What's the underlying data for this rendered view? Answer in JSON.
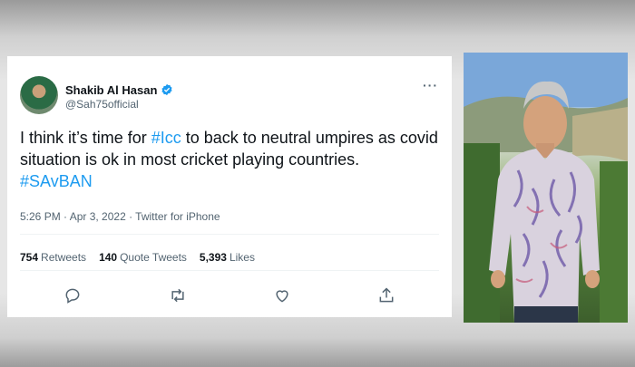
{
  "tweet": {
    "display_name": "Shakib Al Hasan",
    "handle": "@Sah75official",
    "text_part1": "I think it’s time for ",
    "hashtag1": "#Icc",
    "text_part2": " to back to neutral umpires as covid situation is ok in most cricket playing countries.",
    "hashtag2": "#SAvBAN",
    "timestamp": "5:26 PM · Apr 3, 2022 · Twitter for iPhone",
    "stats": {
      "retweets_count": "754",
      "retweets_label": "Retweets",
      "quotes_count": "140",
      "quotes_label": "Quote Tweets",
      "likes_count": "5,393",
      "likes_label": "Likes"
    },
    "more_label": "···"
  },
  "icons": [
    "verified-badge-icon",
    "more-icon",
    "reply-icon",
    "retweet-icon",
    "like-icon",
    "share-icon"
  ],
  "colors": {
    "accent": "#1d9bf0",
    "text": "#0f1419",
    "secondary": "#536471"
  }
}
